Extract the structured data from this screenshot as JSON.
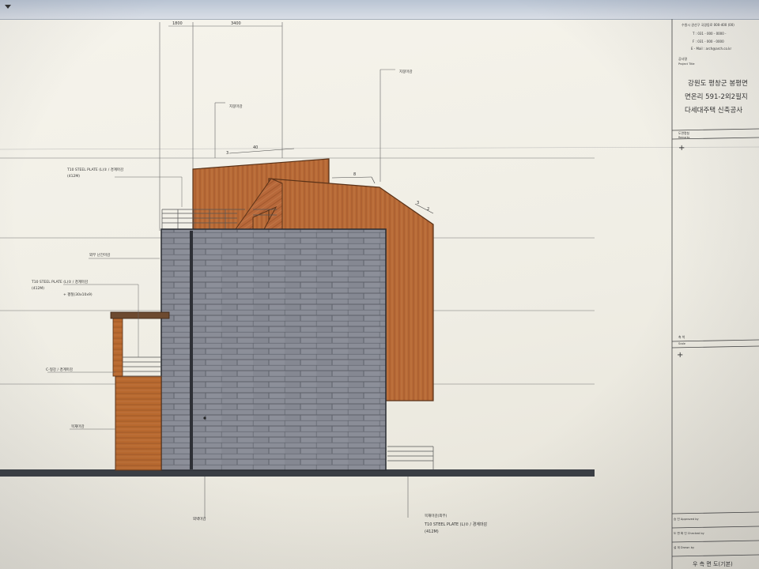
{
  "window": {
    "menu_arrow_icon": "triangle-down-icon"
  },
  "colors": {
    "wood": "#b86a36",
    "masonry": "#7d808a",
    "ground": "#3a3e44",
    "paper": "#f3f1e8"
  },
  "dimensions": {
    "dim_1": "1800",
    "dim_2": "3400"
  },
  "slope_labels": {
    "roof_pitch_top_a": "3",
    "roof_pitch_top_b": "40",
    "roof_pitch_mid": "8",
    "roof_pitch_right_a": "3",
    "roof_pitch_right_b": "2"
  },
  "callouts": {
    "top_marker": "지붕마감",
    "top_right_marker": "지붕마감",
    "steel_plate_top_1": "T10 STEEL PLATE (L)② / 경계마감",
    "steel_plate_top_2": "(412M)",
    "parapet_note": "외부 난간마감",
    "steel_plate_mid_1": "T10 STEEL PLATE (L)② / 경계마감",
    "steel_plate_mid_2": "(412M)",
    "steel_plate_mid_3": "+ 평철(30x10x9)",
    "rail_note": "C-형강 / 경계마감",
    "wood_note": "목재마감",
    "bottom_left_note": "외벽마감",
    "bottom_right_head": "목재마감(외부)",
    "bottom_right_1": "T10 STEEL PLATE (L)② / 경계마감",
    "bottom_right_2": "(412M)"
  },
  "title_block": {
    "address_1": "수원시 권선구 국경동로 000-400 (00)",
    "phone": "T : 031 - 000 - 0000 -",
    "fax": "F : 031 - 000 - 0000",
    "email": "E - Mail : arch@arch.co.kr",
    "project_label": "공사명",
    "project_label_en": "Project Title",
    "project_line_1": "강원도 평창군 봉평면",
    "project_line_2": "면온리 591-2외2필지",
    "project_line_3": "다세대주택  신축공사",
    "drawing_label": "도면명칭",
    "drawing_label_en": "Remarks",
    "scale_label": "축 척",
    "scale_label_en": "Scale",
    "approved_label": "승 인 Approved by",
    "checked_label": "도 면 확 인 Checked by",
    "drawn_label": "설 계 Drawn by",
    "sheet_title": "우 측 면 도(기본)"
  }
}
